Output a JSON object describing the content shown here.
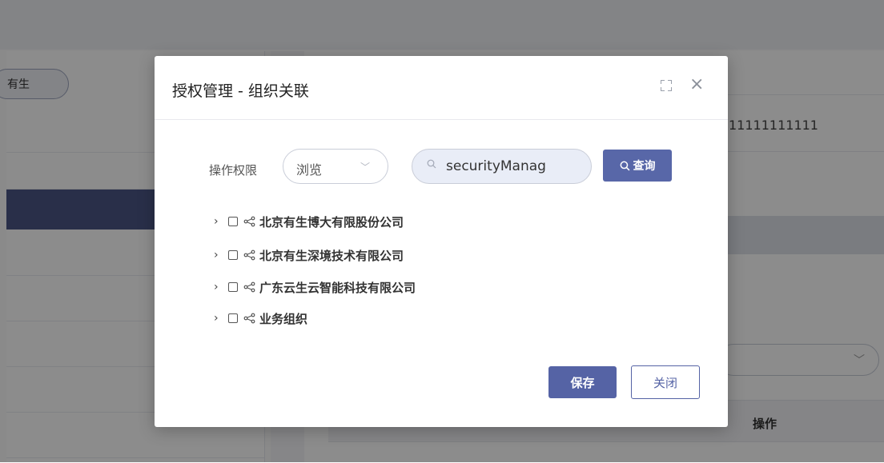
{
  "background": {
    "chip_label": "有生",
    "right_value": "11111111111",
    "table_header_op": "操作"
  },
  "dialog": {
    "title": "授权管理 - 组织关联",
    "permission_label": "操作权限",
    "permission_value": "浏览",
    "search_value": "securityManag",
    "query_label": "查询",
    "tree": [
      {
        "label": "北京有生博大有限股份公司"
      },
      {
        "label": "北京有生深境技术有限公司"
      },
      {
        "label": "广东云生云智能科技有限公司"
      },
      {
        "label": "业务组织"
      }
    ],
    "save_label": "保存",
    "close_label": "关闭"
  },
  "colors": {
    "primary": "#5563a5",
    "search_bg": "#e9edf7",
    "mask": "rgba(0,0,0,0.45)"
  }
}
